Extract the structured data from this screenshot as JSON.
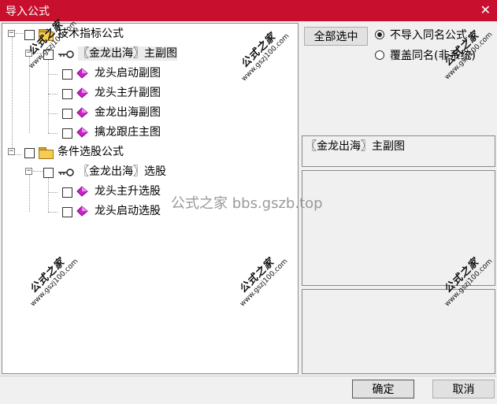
{
  "window": {
    "title": "导入公式",
    "close_glyph": "✕"
  },
  "tree": [
    {
      "expander": "−",
      "type": "folder",
      "label": "技术指标公式"
    },
    {
      "expander": "−",
      "type": "key",
      "label": "〖金龙出海〗主副图",
      "selected": true
    },
    {
      "type": "gem",
      "label": "龙头启动副图"
    },
    {
      "type": "gem",
      "label": "龙头主升副图"
    },
    {
      "type": "gem",
      "label": "金龙出海副图"
    },
    {
      "type": "gem",
      "label": "擒龙跟庄主图"
    },
    {
      "expander": "−",
      "type": "folder",
      "label": "条件选股公式"
    },
    {
      "expander": "−",
      "type": "key",
      "label": "〖金龙出海〗选股"
    },
    {
      "type": "gem",
      "label": "龙头主升选股"
    },
    {
      "type": "gem",
      "label": "龙头启动选股"
    }
  ],
  "right": {
    "select_all": "全部选中",
    "options": [
      {
        "label": "不导入同名公式",
        "checked": true
      },
      {
        "label": "覆盖同名(非系统)",
        "checked": false
      }
    ],
    "selected_name": "〖金龙出海〗主副图"
  },
  "footer": {
    "ok": "确定",
    "cancel": "取消"
  },
  "watermark": {
    "site_cn": "公式之家",
    "site_url": "www.gszj100.com",
    "center": "公式之家 bbs.gszb.top"
  },
  "colors": {
    "titlebar": "#c8102e",
    "gem_magenta": "#cc22cc",
    "folder": "#f4cc55"
  }
}
